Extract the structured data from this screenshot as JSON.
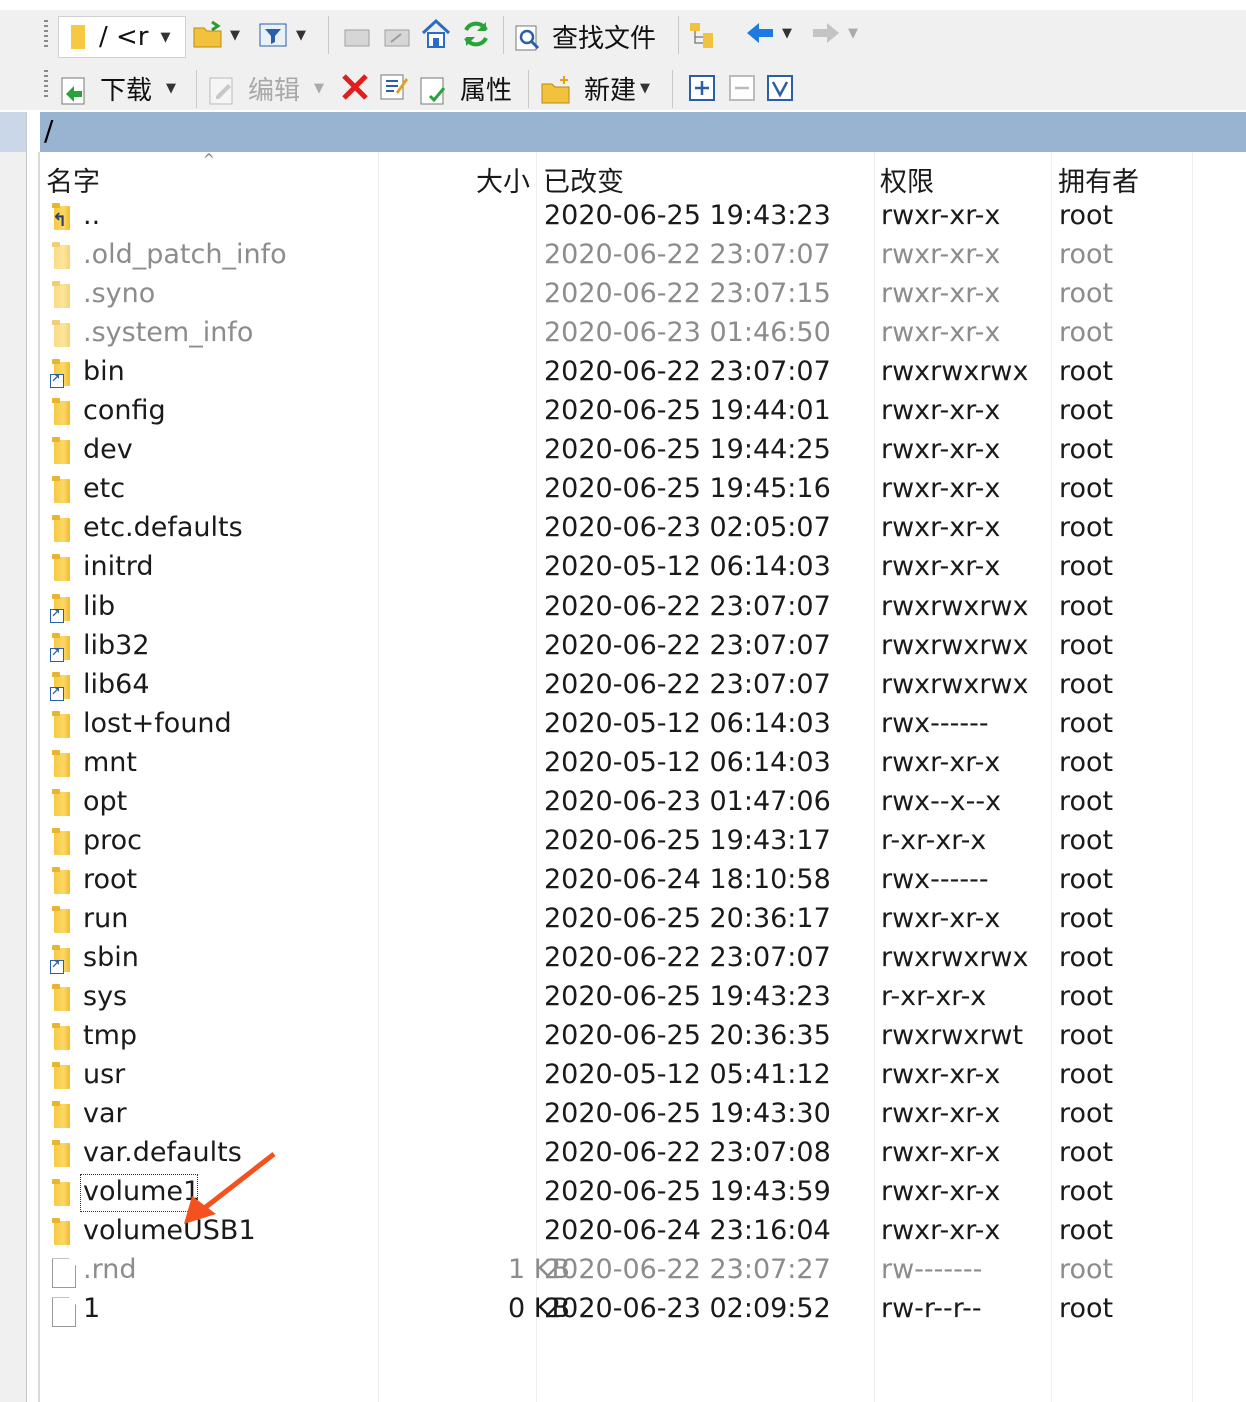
{
  "toolbar1": {
    "path_combo": "/ <r",
    "find_files": "查找文件"
  },
  "toolbar2": {
    "download": "下载",
    "edit": "编辑",
    "properties": "属性",
    "new": "新建"
  },
  "path": "/",
  "columns": {
    "name": "名字",
    "size": "大小",
    "modified": "已改变",
    "permissions": "权限",
    "owner": "拥有者"
  },
  "rows": [
    {
      "name": "..",
      "size": "",
      "modified": "2020-06-25 19:43:23",
      "perm": "rwxr-xr-x",
      "owner": "root",
      "kind": "up",
      "hidden": false
    },
    {
      "name": ".old_patch_info",
      "size": "",
      "modified": "2020-06-22 23:07:07",
      "perm": "rwxr-xr-x",
      "owner": "root",
      "kind": "folder",
      "hidden": true
    },
    {
      "name": ".syno",
      "size": "",
      "modified": "2020-06-22 23:07:15",
      "perm": "rwxr-xr-x",
      "owner": "root",
      "kind": "folder",
      "hidden": true
    },
    {
      "name": ".system_info",
      "size": "",
      "modified": "2020-06-23 01:46:50",
      "perm": "rwxr-xr-x",
      "owner": "root",
      "kind": "folder",
      "hidden": true
    },
    {
      "name": "bin",
      "size": "",
      "modified": "2020-06-22 23:07:07",
      "perm": "rwxrwxrwx",
      "owner": "root",
      "kind": "link",
      "hidden": false
    },
    {
      "name": "config",
      "size": "",
      "modified": "2020-06-25 19:44:01",
      "perm": "rwxr-xr-x",
      "owner": "root",
      "kind": "folder",
      "hidden": false
    },
    {
      "name": "dev",
      "size": "",
      "modified": "2020-06-25 19:44:25",
      "perm": "rwxr-xr-x",
      "owner": "root",
      "kind": "folder",
      "hidden": false
    },
    {
      "name": "etc",
      "size": "",
      "modified": "2020-06-25 19:45:16",
      "perm": "rwxr-xr-x",
      "owner": "root",
      "kind": "folder",
      "hidden": false
    },
    {
      "name": "etc.defaults",
      "size": "",
      "modified": "2020-06-23 02:05:07",
      "perm": "rwxr-xr-x",
      "owner": "root",
      "kind": "folder",
      "hidden": false
    },
    {
      "name": "initrd",
      "size": "",
      "modified": "2020-05-12 06:14:03",
      "perm": "rwxr-xr-x",
      "owner": "root",
      "kind": "folder",
      "hidden": false
    },
    {
      "name": "lib",
      "size": "",
      "modified": "2020-06-22 23:07:07",
      "perm": "rwxrwxrwx",
      "owner": "root",
      "kind": "link",
      "hidden": false
    },
    {
      "name": "lib32",
      "size": "",
      "modified": "2020-06-22 23:07:07",
      "perm": "rwxrwxrwx",
      "owner": "root",
      "kind": "link",
      "hidden": false
    },
    {
      "name": "lib64",
      "size": "",
      "modified": "2020-06-22 23:07:07",
      "perm": "rwxrwxrwx",
      "owner": "root",
      "kind": "link",
      "hidden": false
    },
    {
      "name": "lost+found",
      "size": "",
      "modified": "2020-05-12 06:14:03",
      "perm": "rwx------",
      "owner": "root",
      "kind": "folder",
      "hidden": false
    },
    {
      "name": "mnt",
      "size": "",
      "modified": "2020-05-12 06:14:03",
      "perm": "rwxr-xr-x",
      "owner": "root",
      "kind": "folder",
      "hidden": false
    },
    {
      "name": "opt",
      "size": "",
      "modified": "2020-06-23 01:47:06",
      "perm": "rwx--x--x",
      "owner": "root",
      "kind": "folder",
      "hidden": false
    },
    {
      "name": "proc",
      "size": "",
      "modified": "2020-06-25 19:43:17",
      "perm": "r-xr-xr-x",
      "owner": "root",
      "kind": "folder",
      "hidden": false
    },
    {
      "name": "root",
      "size": "",
      "modified": "2020-06-24 18:10:58",
      "perm": "rwx------",
      "owner": "root",
      "kind": "folder",
      "hidden": false
    },
    {
      "name": "run",
      "size": "",
      "modified": "2020-06-25 20:36:17",
      "perm": "rwxr-xr-x",
      "owner": "root",
      "kind": "folder",
      "hidden": false
    },
    {
      "name": "sbin",
      "size": "",
      "modified": "2020-06-22 23:07:07",
      "perm": "rwxrwxrwx",
      "owner": "root",
      "kind": "link",
      "hidden": false
    },
    {
      "name": "sys",
      "size": "",
      "modified": "2020-06-25 19:43:23",
      "perm": "r-xr-xr-x",
      "owner": "root",
      "kind": "folder",
      "hidden": false
    },
    {
      "name": "tmp",
      "size": "",
      "modified": "2020-06-25 20:36:35",
      "perm": "rwxrwxrwt",
      "owner": "root",
      "kind": "folder",
      "hidden": false
    },
    {
      "name": "usr",
      "size": "",
      "modified": "2020-05-12 05:41:12",
      "perm": "rwxr-xr-x",
      "owner": "root",
      "kind": "folder",
      "hidden": false
    },
    {
      "name": "var",
      "size": "",
      "modified": "2020-06-25 19:43:30",
      "perm": "rwxr-xr-x",
      "owner": "root",
      "kind": "folder",
      "hidden": false
    },
    {
      "name": "var.defaults",
      "size": "",
      "modified": "2020-06-22 23:07:08",
      "perm": "rwxr-xr-x",
      "owner": "root",
      "kind": "folder",
      "hidden": false
    },
    {
      "name": "volume1",
      "size": "",
      "modified": "2020-06-25 19:43:59",
      "perm": "rwxr-xr-x",
      "owner": "root",
      "kind": "folder",
      "hidden": false,
      "focused": true
    },
    {
      "name": "volumeUSB1",
      "size": "",
      "modified": "2020-06-24 23:16:04",
      "perm": "rwxr-xr-x",
      "owner": "root",
      "kind": "folder",
      "hidden": false
    },
    {
      "name": ".rnd",
      "size": "1 KB",
      "modified": "2020-06-22 23:07:27",
      "perm": "rw-------",
      "owner": "root",
      "kind": "file",
      "hidden": true
    },
    {
      "name": "1",
      "size": "0 KB",
      "modified": "2020-06-23 02:09:52",
      "perm": "rw-r--r--",
      "owner": "root",
      "kind": "file",
      "hidden": false
    }
  ],
  "annotation": {
    "arrow_color": "#f4511e"
  },
  "colors": {
    "path_bar": "#99b4d1",
    "toolbar_bg": "#f0f0f0"
  }
}
